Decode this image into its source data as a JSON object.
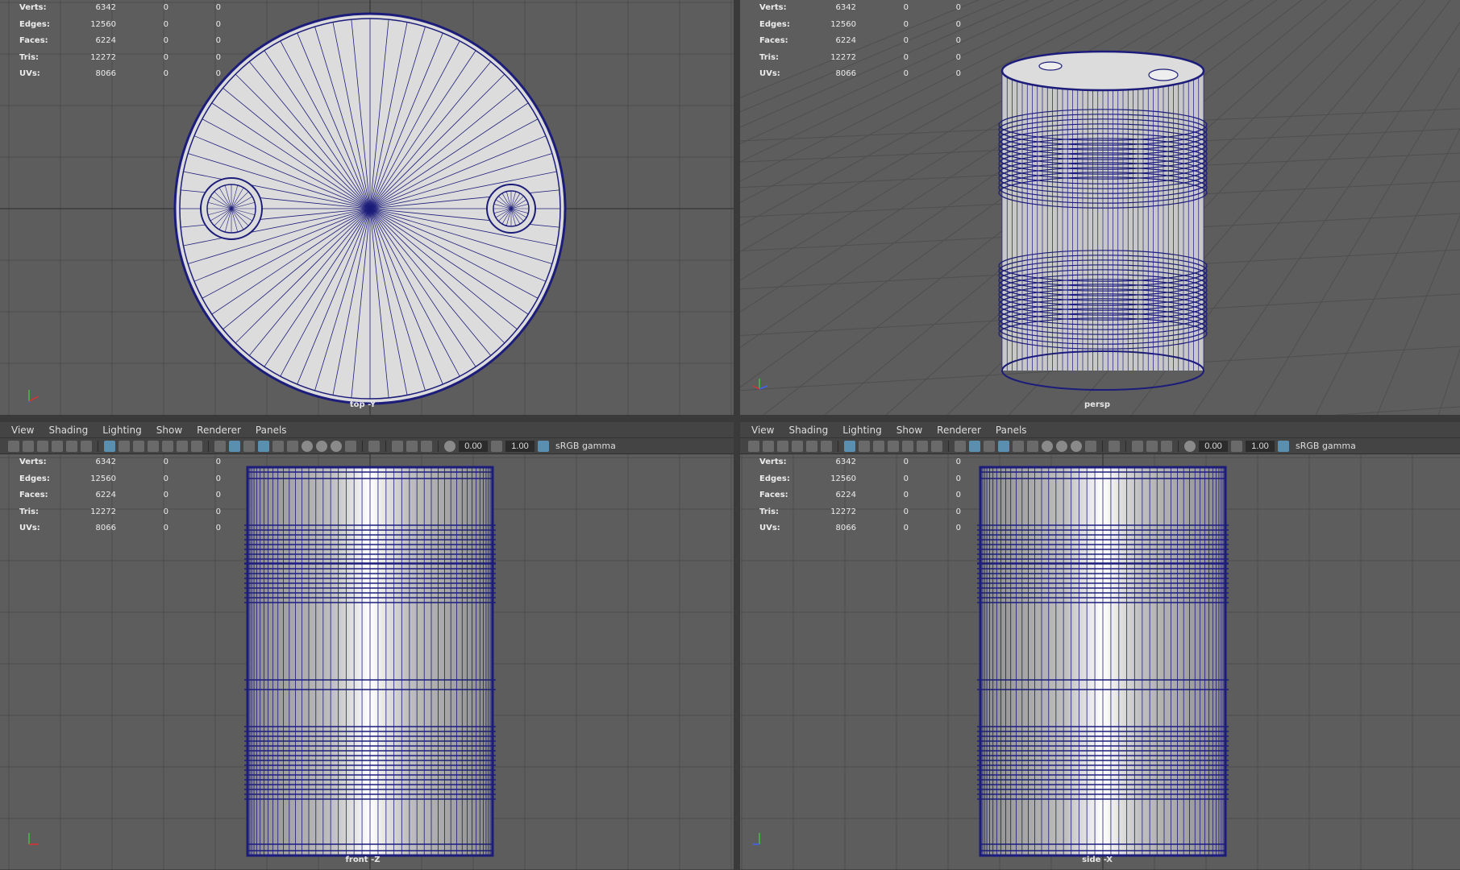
{
  "viewports": {
    "top": {
      "camera_label": "top -Y"
    },
    "persp": {
      "camera_label": "persp"
    },
    "front": {
      "camera_label": "front -Z"
    },
    "side": {
      "camera_label": "side -X"
    }
  },
  "hud": {
    "rows": [
      {
        "label": "Verts:",
        "value": "6342",
        "a": "0",
        "b": "0"
      },
      {
        "label": "Edges:",
        "value": "12560",
        "a": "0",
        "b": "0"
      },
      {
        "label": "Faces:",
        "value": "6224",
        "a": "0",
        "b": "0"
      },
      {
        "label": "Tris:",
        "value": "12272",
        "a": "0",
        "b": "0"
      },
      {
        "label": "UVs:",
        "value": "8066",
        "a": "0",
        "b": "0"
      }
    ]
  },
  "panel_menu": {
    "items": [
      "View",
      "Shading",
      "Lighting",
      "Show",
      "Renderer",
      "Panels"
    ]
  },
  "panel_toolbar": {
    "exposure": "0.00",
    "gamma": "1.00",
    "color_space": "sRGB gamma"
  },
  "icons": {
    "camera": "camera-icon",
    "grid": "grid-icon",
    "wireframe": "wireframe-icon",
    "smooth_shade": "smooth-shade-icon",
    "exposure": "exposure-icon",
    "gamma": "gamma-icon",
    "color_management": "color-management-icon",
    "axis_gizmo": "axis-gizmo-icon"
  },
  "colors": {
    "viewport_bg": "#5d5d5d",
    "grid_line": "#4a4a4a",
    "wire": "#1c1c7a",
    "ui_bg": "#444444",
    "ui_text": "#dddddd"
  }
}
